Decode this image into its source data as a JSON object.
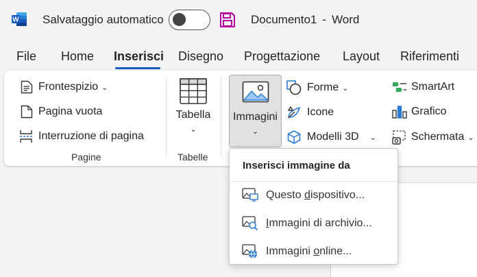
{
  "titlebar": {
    "app_icon": "word-icon",
    "autosave_label": "Salvataggio automatico",
    "autosave_state": "off",
    "save_icon": "save-icon",
    "doc_name": "Documento1",
    "separator": "-",
    "app_name": "Word"
  },
  "tabs": [
    {
      "label": "File",
      "active": false
    },
    {
      "label": "Home",
      "active": false
    },
    {
      "label": "Inserisci",
      "active": true
    },
    {
      "label": "Disegno",
      "active": false
    },
    {
      "label": "Progettazione",
      "active": false
    },
    {
      "label": "Layout",
      "active": false
    },
    {
      "label": "Riferimenti",
      "active": false
    }
  ],
  "ribbon": {
    "pagine": {
      "frontespizio": "Frontespizio",
      "pagina_vuota": "Pagina vuota",
      "interruzione": "Interruzione di pagina",
      "group_label": "Pagine"
    },
    "tabelle": {
      "tabella": "Tabella",
      "group_label": "Tabelle"
    },
    "illustrazioni": {
      "immagini": "Immagini",
      "forme": "Forme",
      "icone": "Icone",
      "modelli3d": "Modelli 3D",
      "smartart": "SmartArt",
      "grafico": "Grafico",
      "schermata": "Schermata"
    }
  },
  "dropdown": {
    "header": "Inserisci immagine da",
    "items": [
      {
        "pre": "Questo ",
        "accel": "d",
        "post": "ispositivo...",
        "icon": "device-image-icon"
      },
      {
        "pre": "",
        "accel": "I",
        "post": "mmagini di archivio...",
        "icon": "stock-image-icon"
      },
      {
        "pre": "Immagini ",
        "accel": "o",
        "post": "nline...",
        "icon": "online-image-icon"
      }
    ]
  },
  "colors": {
    "accent": "#185abd",
    "word_blue": "#185abd",
    "save_purple": "#b4009e"
  }
}
